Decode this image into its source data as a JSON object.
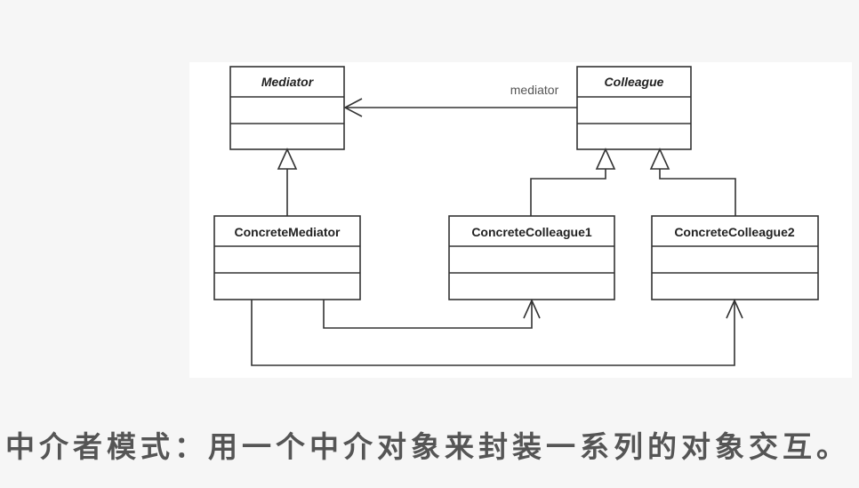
{
  "diagram": {
    "classes": [
      {
        "id": "mediator",
        "name": "Mediator",
        "abstract": true
      },
      {
        "id": "colleague",
        "name": "Colleague",
        "abstract": true
      },
      {
        "id": "concrete-mediator",
        "name": "ConcreteMediator",
        "abstract": false
      },
      {
        "id": "concrete-colleague1",
        "name": "ConcreteColleague1",
        "abstract": false
      },
      {
        "id": "concrete-colleague2",
        "name": "ConcreteColleague2",
        "abstract": false
      }
    ],
    "relations": [
      {
        "type": "association",
        "from": "Colleague",
        "to": "Mediator",
        "label": "mediator"
      },
      {
        "type": "generalization",
        "from": "ConcreteMediator",
        "to": "Mediator"
      },
      {
        "type": "generalization",
        "from": "ConcreteColleague1",
        "to": "Colleague"
      },
      {
        "type": "generalization",
        "from": "ConcreteColleague2",
        "to": "Colleague"
      },
      {
        "type": "association",
        "from": "ConcreteMediator",
        "to": "ConcreteColleague1"
      },
      {
        "type": "association",
        "from": "ConcreteMediator",
        "to": "ConcreteColleague2"
      }
    ]
  },
  "caption": "中介者模式：用一个中介对象来封装一系列的对象交互。"
}
